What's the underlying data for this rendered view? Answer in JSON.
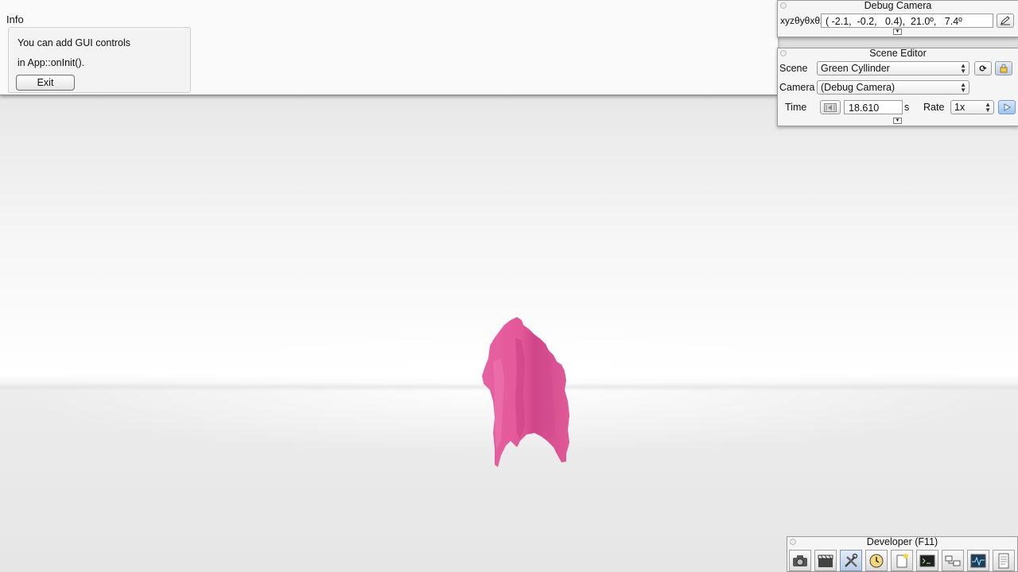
{
  "info": {
    "title": "Info",
    "line1": "You can add GUI controls",
    "line2": "in App::onInit().",
    "exit_label": "Exit"
  },
  "debug_camera": {
    "title": "Debug Camera",
    "frame_label": "xyzθyθxθz",
    "frame_value": "( -2.1,  -0.2,   0.4),  21.0º,   7.4º"
  },
  "scene_editor": {
    "title": "Scene Editor",
    "scene_label": "Scene",
    "scene_value": "Green Cyllinder",
    "camera_label": "Camera",
    "camera_value": "(Debug Camera)",
    "time_label": "Time",
    "time_value": "18.610",
    "time_unit": "s",
    "rate_label": "Rate",
    "rate_value": "1x"
  },
  "developer": {
    "title": "Developer (F11)",
    "tools": [
      "camera-icon",
      "film-clapper-icon",
      "tools-icon",
      "clock-icon",
      "new-document-icon",
      "console-icon",
      "network-icon",
      "profiler-icon",
      "log-icon"
    ]
  },
  "colors": {
    "object": "#e35797",
    "object_dark": "#c83e7e",
    "play_button": "#9ec3ea"
  }
}
